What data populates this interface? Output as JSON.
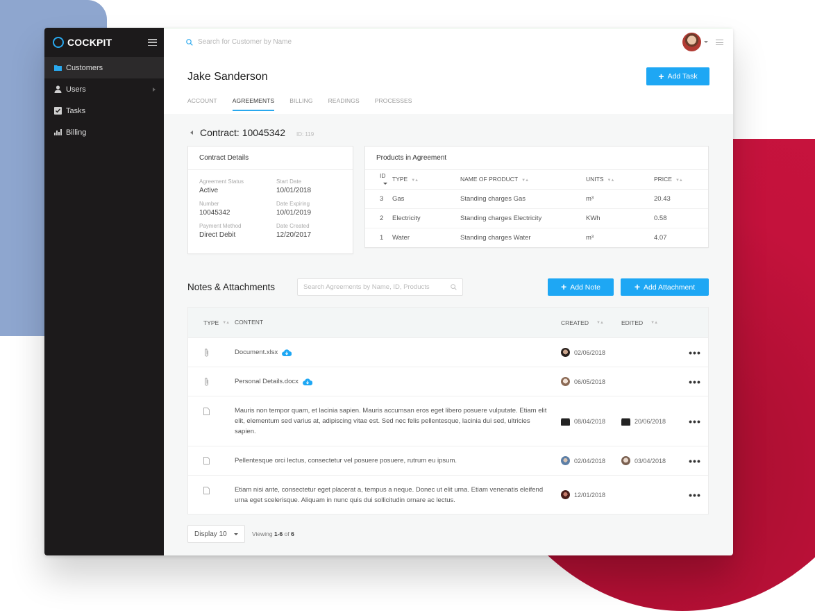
{
  "sidebar": {
    "brand": "COCKPIT",
    "items": [
      {
        "label": "Customers",
        "icon": "folder-icon",
        "active": true
      },
      {
        "label": "Users",
        "icon": "user-icon",
        "has_submenu": true
      },
      {
        "label": "Tasks",
        "icon": "checkbox-icon"
      },
      {
        "label": "Billing",
        "icon": "bar-chart-icon"
      }
    ]
  },
  "header": {
    "search_placeholder": "Search for Customer by Name",
    "customer_name": "Jake Sanderson",
    "add_task_label": "Add Task",
    "tabs": [
      {
        "label": "ACCOUNT"
      },
      {
        "label": "AGREEMENTS",
        "active": true
      },
      {
        "label": "BILLING"
      },
      {
        "label": "READINGS"
      },
      {
        "label": "PROCESSES"
      }
    ]
  },
  "contract": {
    "title": "Contract: 10045342",
    "id_label": "ID: 119"
  },
  "contract_details": {
    "title": "Contract Details",
    "fields": [
      {
        "label": "Agreement Status",
        "value": "Active"
      },
      {
        "label": "Start Date",
        "value": "10/01/2018"
      },
      {
        "label": "Number",
        "value": "10045342"
      },
      {
        "label": "Date Expiring",
        "value": "10/01/2019"
      },
      {
        "label": "Payment Method",
        "value": "Direct Debit"
      },
      {
        "label": "Date Created",
        "value": "12/20/2017"
      }
    ]
  },
  "products": {
    "title": "Products in Agreement",
    "columns": [
      "ID",
      "TYPE",
      "NAME OF PRODUCT",
      "UNITS",
      "PRICE"
    ],
    "rows": [
      {
        "id": "3",
        "type": "Gas",
        "name": "Standing charges Gas",
        "units": "m³",
        "price": "20.43"
      },
      {
        "id": "2",
        "type": "Electricity",
        "name": "Standing charges Electricity",
        "units": "KWh",
        "price": "0.58"
      },
      {
        "id": "1",
        "type": "Water",
        "name": "Standing charges Water",
        "units": "m³",
        "price": "4.07"
      }
    ]
  },
  "notes": {
    "title": "Notes & Attachments",
    "search_placeholder": "Search Agreements by Name, ID, Products",
    "add_note_label": "Add Note",
    "add_attachment_label": "Add Attachment",
    "columns": {
      "type": "TYPE",
      "content": "CONTENT",
      "created": "CREATED",
      "edited": "EDITED"
    },
    "rows": [
      {
        "type": "attachment",
        "content": "Document.xlsx",
        "created": "02/06/2018",
        "edited": ""
      },
      {
        "type": "attachment",
        "content": "Personal Details.docx",
        "created": "06/05/2018",
        "edited": ""
      },
      {
        "type": "note",
        "content": "Mauris non tempor quam, et lacinia sapien. Mauris accumsan eros eget libero posuere vulputate. Etiam elit elit, elementum sed varius at, adipiscing vitae est. Sed nec felis pellentesque, lacinia dui sed, ultricies sapien.",
        "created": "08/04/2018",
        "edited": "20/06/2018"
      },
      {
        "type": "note",
        "content": "Pellentesque orci lectus, consectetur vel posuere posuere, rutrum eu ipsum.",
        "created": "02/04/2018",
        "edited": "03/04/2018"
      },
      {
        "type": "note",
        "content": "Etiam nisi ante, consectetur eget placerat a, tempus a neque. Donec ut elit urna. Etiam venenatis eleifend urna eget scelerisque. Aliquam in nunc quis dui sollicitudin ornare ac lectus.",
        "created": "12/01/2018",
        "edited": ""
      }
    ],
    "more_label": "•••"
  },
  "footer": {
    "display_label": "Display 10",
    "viewing_prefix": "Viewing ",
    "viewing_range": "1-6",
    "viewing_of": " of ",
    "viewing_total": "6"
  },
  "colors": {
    "accent": "#1ea7f4",
    "sidebar_bg": "#1c1a1b",
    "bg_blue": "#8ea6cf",
    "bg_red": "#c4123c"
  }
}
